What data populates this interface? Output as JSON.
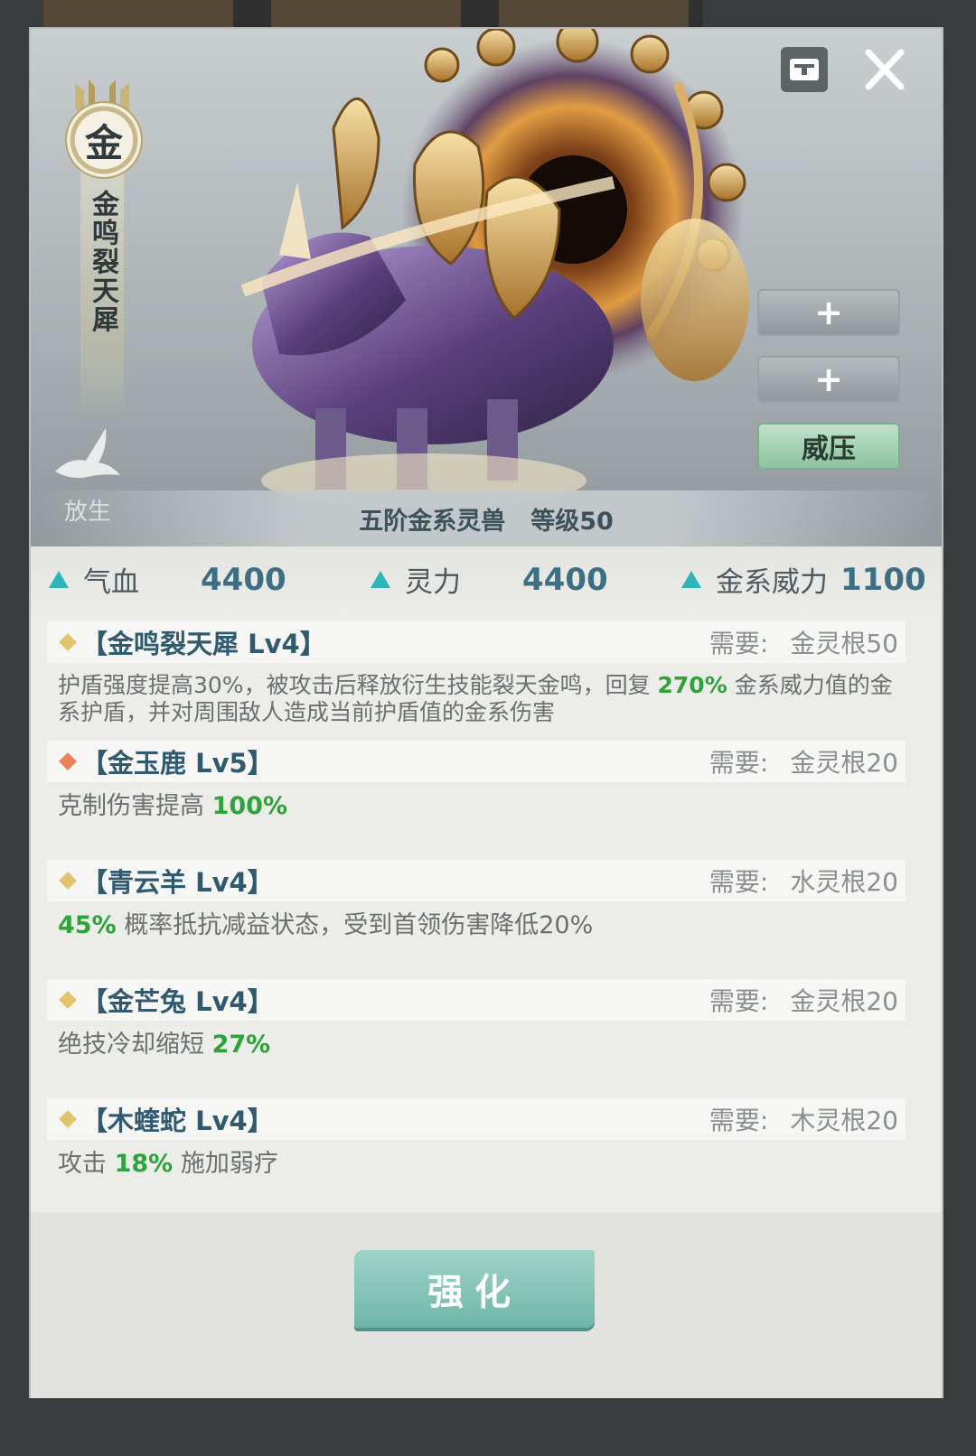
{
  "beast": {
    "element_badge": "金",
    "name": "金鸣裂天犀",
    "rank_text": "五阶金系灵兽",
    "level_text": "等级50"
  },
  "hero_buttons": {
    "release_label": "放生",
    "slot1_label": "+",
    "slot2_label": "+",
    "pressure_label": "威压"
  },
  "stats": [
    {
      "label": "气血",
      "value": "4400"
    },
    {
      "label": "灵力",
      "value": "4400"
    },
    {
      "label": "金系威力",
      "value": "1100"
    }
  ],
  "skills": [
    {
      "name": "【金鸣裂天犀 Lv4】",
      "req_key": "需要:",
      "req_value": "金灵根50",
      "desc_a": "护盾强度提高30%，被攻击后释放衍生技能裂天金鸣，回复 ",
      "desc_hl": "270%",
      "desc_b": " 金系威力值的金系护盾，并对周围敌人造成当前护盾值的金系伤害",
      "diamond_color": "#e3c36a"
    },
    {
      "name": "【金玉鹿 Lv5】",
      "req_key": "需要:",
      "req_value": "金灵根20",
      "desc_a": "克制伤害提高 ",
      "desc_hl": "100%",
      "desc_b": "",
      "diamond_color": "#ef7f55"
    },
    {
      "name": "【青云羊 Lv4】",
      "req_key": "需要:",
      "req_value": "水灵根20",
      "desc_a": "",
      "desc_hl": "45%",
      "desc_b": " 概率抵抗减益状态，受到首领伤害降低20%",
      "diamond_color": "#e3c36a"
    },
    {
      "name": "【金芒兔 Lv4】",
      "req_key": "需要:",
      "req_value": "金灵根20",
      "desc_a": "绝技冷却缩短 ",
      "desc_hl": "27%",
      "desc_b": "",
      "diamond_color": "#e3c36a"
    },
    {
      "name": "【木蝰蛇 Lv4】",
      "req_key": "需要:",
      "req_value": "木灵根20",
      "desc_a": "攻击 ",
      "desc_hl": "18%",
      "desc_b": " 施加弱疗",
      "diamond_color": "#e3c36a"
    }
  ],
  "actions": {
    "strengthen_label": "强化"
  },
  "colors": {
    "accent_teal": "#2eb5b7",
    "highlight_green": "#2ea33a",
    "title_blue": "#2f5a70"
  },
  "icons": [
    "tag-icon",
    "close-icon",
    "dove-icon",
    "triangle-icon",
    "diamond-icon"
  ]
}
